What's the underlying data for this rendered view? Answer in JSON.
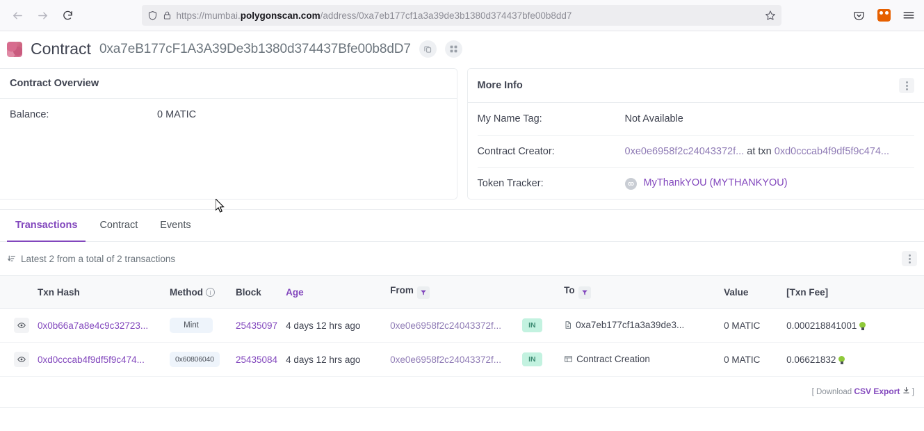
{
  "browser": {
    "back_icon": "back-arrow-icon",
    "forward_icon": "forward-arrow-icon",
    "reload_icon": "reload-icon",
    "shield_icon": "shield-icon",
    "lock_icon": "lock-icon",
    "url_prefix": "https://mumbai.",
    "url_domain": "polygonscan.com",
    "url_suffix": "/address/0xa7eb177cf1a3a39de3b1380d374437bfe00b8dd7",
    "url_full": "https://mumbai.polygonscan.com/address/0xa7eb177cf1a3a39de3b1380d374437bfe00b8dd7",
    "bookmark_icon": "star-icon",
    "pocket_icon": "pocket-icon",
    "extension_icon": "metamask-fox-icon",
    "menu_icon": "hamburger-menu-icon"
  },
  "header": {
    "avatar": "contract-identicon",
    "title": "Contract",
    "address": "0xa7eB177cF1A3A39De3b1380d374437Bfe00b8dD7",
    "copy_icon": "copy-icon",
    "qr_icon": "qr-code-icon"
  },
  "overview": {
    "title": "Contract Overview",
    "rows": [
      {
        "label": "Balance:",
        "value": "0 MATIC"
      }
    ]
  },
  "more_info": {
    "title": "More Info",
    "kebab_icon": "more-options-icon",
    "name_tag": {
      "label": "My Name Tag:",
      "value": "Not Available"
    },
    "creator": {
      "label": "Contract Creator:",
      "address": "0xe0e6958f2c24043372f...",
      "at_txn": "at txn",
      "txn": "0xd0cccab4f9df5f9c474..."
    },
    "token_tracker": {
      "label": "Token Tracker:",
      "icon": "token-placeholder-icon",
      "value": "MyThankYOU (MYTHANKYOU)"
    }
  },
  "tabs": [
    {
      "label": "Transactions",
      "active": true
    },
    {
      "label": "Contract",
      "active": false
    },
    {
      "label": "Events",
      "active": false
    }
  ],
  "tx_panel": {
    "sort_icon": "sort-descending-icon",
    "summary": "Latest 2 from a total of 2 transactions",
    "kebab_icon": "more-options-icon",
    "columns": {
      "txn_hash": "Txn Hash",
      "method": "Method",
      "method_info_icon": "info-icon",
      "block": "Block",
      "age": "Age",
      "from": "From",
      "from_filter_icon": "filter-icon",
      "to": "To",
      "to_filter_icon": "filter-icon",
      "value": "Value",
      "txn_fee": "[Txn Fee]"
    },
    "rows": [
      {
        "eye_icon": "eye-icon",
        "hash": "0x0b66a7a8e4c9c32723...",
        "method": "Mint",
        "method_style": "text",
        "block": "25435097",
        "age": "4 days 12 hrs ago",
        "from": "0xe0e6958f2c24043372f...",
        "direction": "IN",
        "to_icon": "contract-file-icon",
        "to": "0xa7eb177cf1a3a39de3...",
        "value": "0 MATIC",
        "fee": "0.000218841001"
      },
      {
        "eye_icon": "eye-icon",
        "hash": "0xd0cccab4f9df5f9c474...",
        "method": "0x60806040",
        "method_style": "hex",
        "block": "25435084",
        "age": "4 days 12 hrs ago",
        "from": "0xe0e6958f2c24043372f...",
        "direction": "IN",
        "to_icon": "contract-creation-icon",
        "to": "Contract Creation",
        "value": "0 MATIC",
        "fee": "0.06621832"
      }
    ],
    "footer": {
      "bracket_open": "[",
      "download_label": "Download",
      "csv_label": "CSV Export",
      "download_icon": "download-icon",
      "bracket_close": "]"
    }
  },
  "colors": {
    "accent": "#8247bd",
    "in_badge_bg": "#c3f2e0",
    "in_badge_text": "#3f8c74",
    "method_badge_bg": "#eef4fb"
  }
}
